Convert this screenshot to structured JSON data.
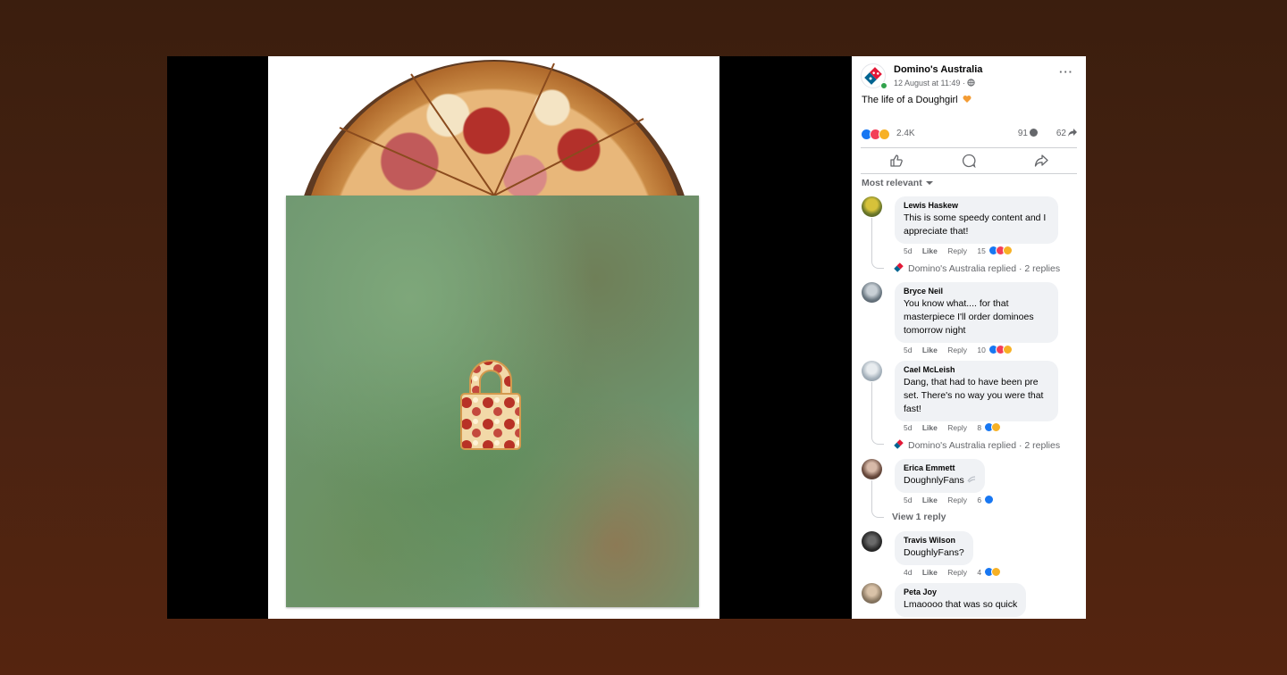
{
  "post": {
    "page_name": "Domino's Australia",
    "date": "12 August at 11:49 ·",
    "caption": "The life of a Doughgirl",
    "reaction_count": "2.4K",
    "comment_count": "91",
    "share_count": "62",
    "sort_label": "Most relevant",
    "colors": {
      "accent": "#1877f2",
      "love": "#f33e58",
      "haha": "#f7b125",
      "online": "#31a24c"
    }
  },
  "comments": [
    {
      "name": "Lewis Haskew",
      "text": "This is some speedy content and I appreciate that!",
      "time": "5d",
      "like": "Like",
      "reply": "Reply",
      "reacts": "15",
      "replied": "Domino's Australia replied · 2 replies"
    },
    {
      "name": "Bryce Neil",
      "text": "You know what.... for that masterpiece I'll order dominoes tomorrow night",
      "time": "5d",
      "like": "Like",
      "reply": "Reply",
      "reacts": "10"
    },
    {
      "name": "Cael McLeish",
      "text": "Dang, that had to have been pre set. There's no way you were that fast!",
      "time": "5d",
      "like": "Like",
      "reply": "Reply",
      "reacts": "8",
      "replied": "Domino's Australia replied · 2 replies"
    },
    {
      "name": "Erica Emmett",
      "text": "DoughnlyFans",
      "time": "5d",
      "like": "Like",
      "reply": "Reply",
      "reacts": "6",
      "view_reply": "View 1 reply"
    },
    {
      "name": "Travis Wilson",
      "text": "DoughlyFans?",
      "time": "4d",
      "like": "Like",
      "reply": "Reply",
      "reacts": "4"
    },
    {
      "name": "Peta Joy",
      "text": "Lmaoooo that was so quick"
    }
  ]
}
